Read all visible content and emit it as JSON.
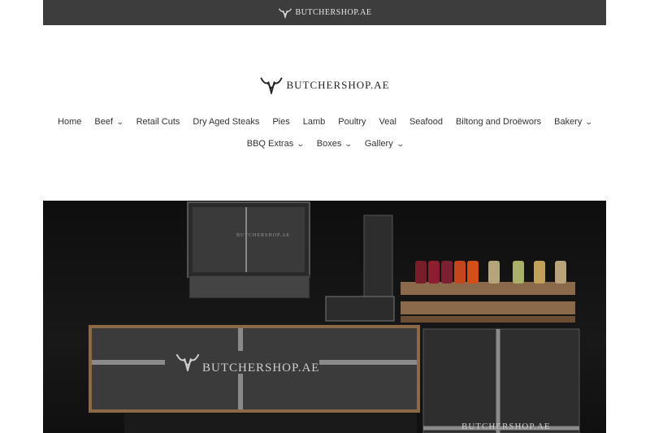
{
  "header": {
    "topbar_logo_text": "BUTCHERSHOP.AE",
    "brand_logo_text": "BUTCHERSHOP.AE"
  },
  "nav": {
    "row1": [
      {
        "label": "Home",
        "dropdown": false
      },
      {
        "label": "Beef",
        "dropdown": true
      },
      {
        "label": "Retail Cuts",
        "dropdown": false
      },
      {
        "label": "Dry Aged Steaks",
        "dropdown": false
      },
      {
        "label": "Pies",
        "dropdown": false
      },
      {
        "label": "Lamb",
        "dropdown": false
      },
      {
        "label": "Poultry",
        "dropdown": false
      },
      {
        "label": "Veal",
        "dropdown": false
      },
      {
        "label": "Seafood",
        "dropdown": false
      },
      {
        "label": "Biltong and Droëwors",
        "dropdown": false
      },
      {
        "label": "Bakery",
        "dropdown": true
      }
    ],
    "row2": [
      {
        "label": "BBQ Extras",
        "dropdown": true
      },
      {
        "label": "Boxes",
        "dropdown": true
      },
      {
        "label": "Gallery",
        "dropdown": true
      }
    ]
  },
  "hero": {
    "sign_text_main": "BUTCHERSHOP.AE",
    "sign_text_right": "BUTCHERSHOP.AE",
    "sign_text_grill": "BUTCHERSHOP.AE"
  }
}
